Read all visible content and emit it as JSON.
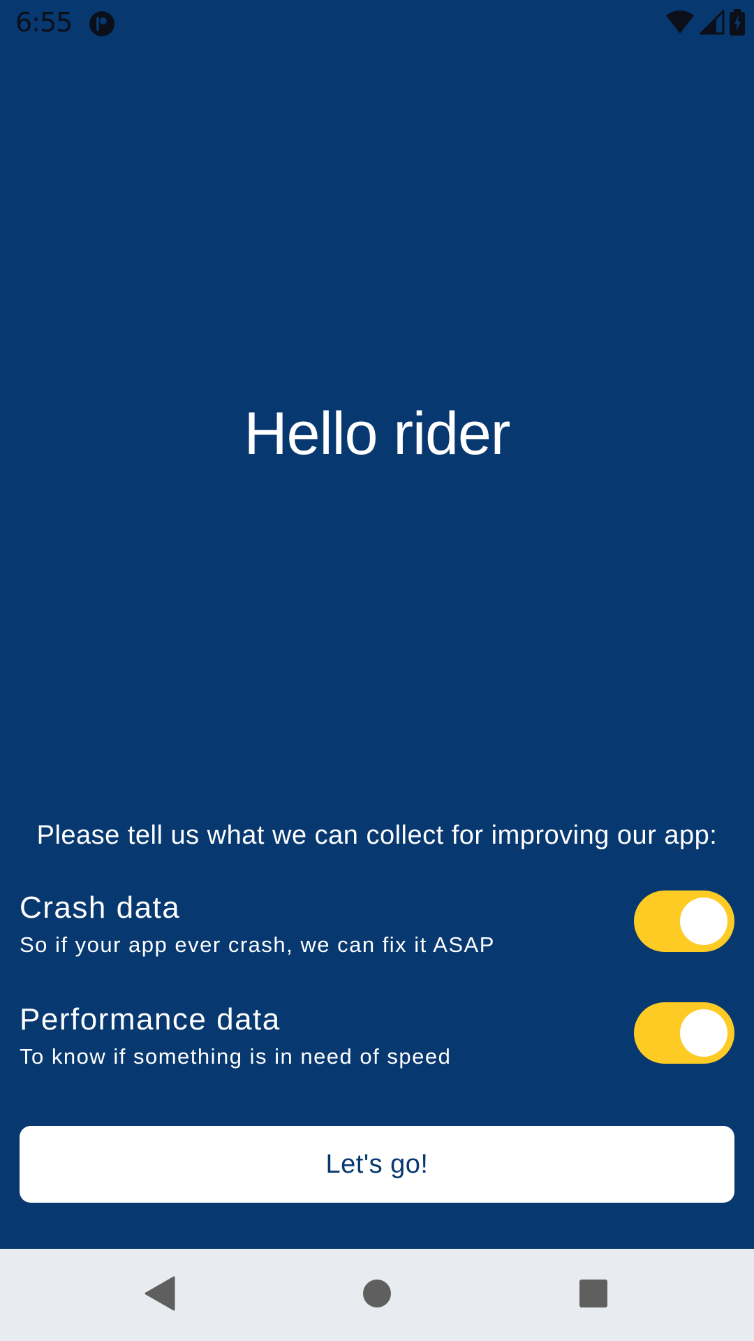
{
  "status_bar": {
    "time": "6:55",
    "icons": [
      "app-notification-icon",
      "wifi-icon",
      "cellular-signal-icon",
      "battery-charging-icon"
    ]
  },
  "main": {
    "title": "Hello rider",
    "prompt": "Please tell us what we can collect for improving our app:",
    "settings": [
      {
        "title": "Crash data",
        "description": "So if your app ever crash, we can fix it ASAP",
        "enabled": true
      },
      {
        "title": "Performance data",
        "description": "To know if something is in need of speed",
        "enabled": true
      }
    ],
    "cta_label": "Let's go!"
  },
  "nav_bar": {
    "buttons": [
      "back-icon",
      "home-icon",
      "recents-icon"
    ]
  },
  "colors": {
    "background": "#073870",
    "accent": "#fdcb24",
    "button_bg": "#ffffff",
    "nav_bg": "#e8ebef"
  }
}
